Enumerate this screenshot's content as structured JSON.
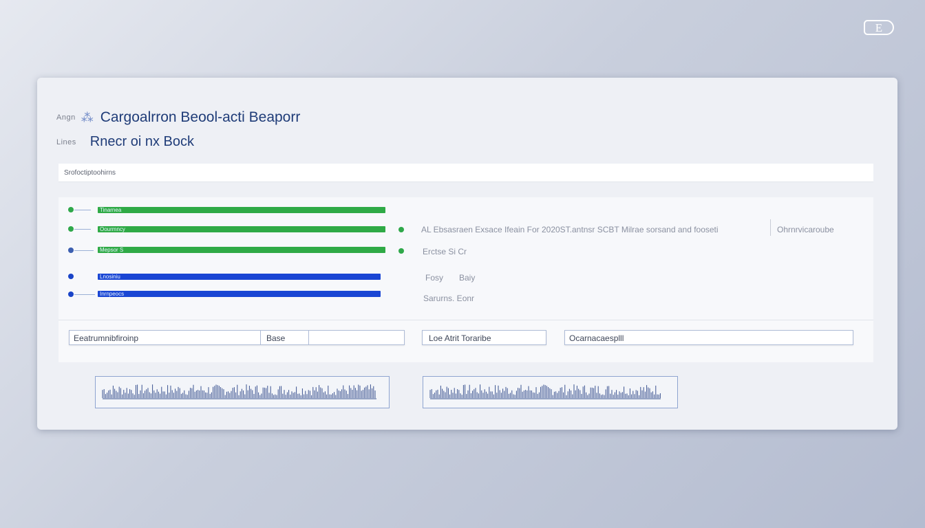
{
  "corner_badge": "E",
  "header": {
    "small1": "Angn",
    "title": "Cargoalrron Beool-acti Beaporr",
    "small2": "Lines",
    "subtitle": "Rnecr oi nx Bock"
  },
  "section_label": "Srofoctiptoohirns",
  "bars": [
    {
      "label": "Tinarnea",
      "color": "green"
    },
    {
      "label": "Oourmncy",
      "color": "green"
    },
    {
      "label": "Mepsor S",
      "color": "green"
    },
    {
      "label": "Lnosiniu",
      "color": "blue"
    },
    {
      "label": "Inrnpeocs",
      "color": "blue"
    }
  ],
  "info": {
    "line1": "AL Ebsasraen Exsace Ifeain For 2020ST.antnsr SCBT Milrae sorsand and fooseti",
    "aside": "Ohrnrvicaroube",
    "line2": "Erctse Si Cr",
    "line3a": "Fosy",
    "line3b": "Baiy",
    "line4": "Sarurns. Eonr"
  },
  "fields": {
    "f1_label": "Eeatrumnibfiroinp",
    "f1_value": "Base",
    "f2_label": "Loe Atrit Toraribe",
    "f3_label": "Ocarnacaesplll"
  },
  "icons": {
    "title_icon": "link-icon",
    "sub_icon": "bullet-icon"
  }
}
